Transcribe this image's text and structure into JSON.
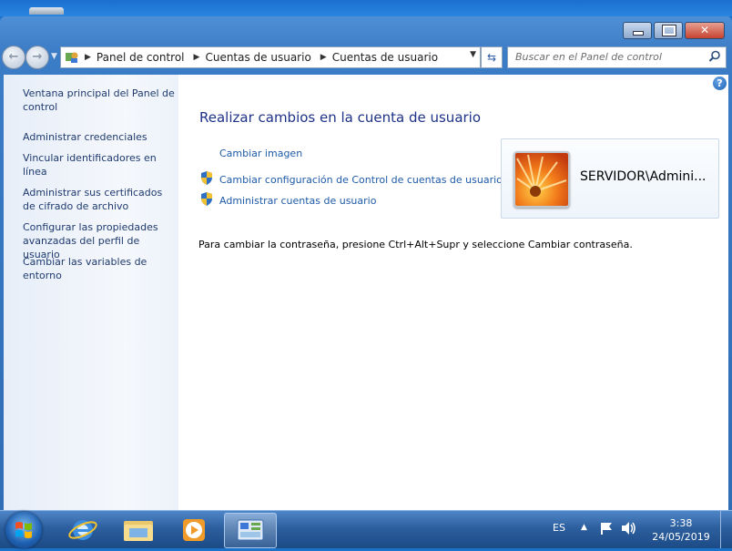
{
  "window": {
    "buttons": {
      "minimize": "minimize",
      "maximize": "maximize",
      "close": "close"
    }
  },
  "navigation": {
    "breadcrumb": [
      "Panel de control",
      "Cuentas de usuario",
      "Cuentas de usuario"
    ],
    "search_placeholder": "Buscar en el Panel de control"
  },
  "sidebar": {
    "items": [
      {
        "label": "Ventana principal del Panel de control"
      },
      {
        "label": "Administrar credenciales"
      },
      {
        "label": "Vincular identificadores en línea"
      },
      {
        "label": "Administrar sus certificados de cifrado de archivo"
      },
      {
        "label": "Configurar las propiedades avanzadas del perfil de usuario"
      },
      {
        "label": "Cambiar las variables de entorno"
      }
    ]
  },
  "main": {
    "title": "Realizar cambios en la cuenta de usuario",
    "links": [
      {
        "label": "Cambiar imagen"
      },
      {
        "label": "Cambiar configuración de Control de cuentas de usuario"
      },
      {
        "label": "Administrar cuentas de usuario"
      }
    ],
    "account_name": "SERVIDOR\\Admini...",
    "info_text": "Para cambiar la contraseña, presione Ctrl+Alt+Supr y seleccione Cambiar contraseña."
  },
  "taskbar": {
    "apps": [
      "internet-explorer",
      "file-explorer",
      "media-player",
      "control-panel"
    ],
    "language": "ES",
    "time": "3:38",
    "date": "24/05/2019"
  },
  "colors": {
    "link": "#1e5aa8",
    "title": "#1e3287",
    "sidebar_link": "#1e3a6e"
  }
}
